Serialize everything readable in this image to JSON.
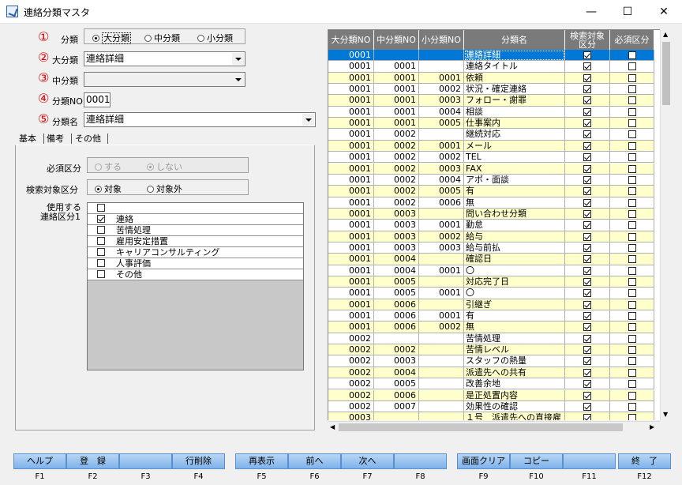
{
  "window": {
    "title": "連絡分類マスタ",
    "minimize": "—",
    "maximize": "☐",
    "close": "✕"
  },
  "markers": [
    "①",
    "②",
    "③",
    "④",
    "⑤"
  ],
  "form": {
    "bunrui_label": "分類",
    "bunrui_options": [
      {
        "label": "大分類",
        "selected": true
      },
      {
        "label": "中分類",
        "selected": false
      },
      {
        "label": "小分類",
        "selected": false
      }
    ],
    "dai_label": "大分類",
    "dai_value": "連絡詳細",
    "chu_label": "中分類",
    "chu_value": "",
    "no_label": "分類NO",
    "no_value": "0001",
    "name_label": "分類名",
    "name_value": "連絡詳細"
  },
  "tabs": [
    "基本",
    "備考",
    "その他"
  ],
  "panel": {
    "hissu_label": "必須区分",
    "hissu_options": [
      {
        "label": "する",
        "selected": false
      },
      {
        "label": "しない",
        "selected": true
      }
    ],
    "kensaku_label": "検索対象区分",
    "kensaku_options": [
      {
        "label": "対象",
        "selected": true
      },
      {
        "label": "対象外",
        "selected": false
      }
    ],
    "usage_label_1": "使用する",
    "usage_label_2": "連絡区分1",
    "usage_items": [
      {
        "label": "",
        "checked": false
      },
      {
        "label": "連絡",
        "checked": true
      },
      {
        "label": "苦情処理",
        "checked": false
      },
      {
        "label": "雇用安定措置",
        "checked": false
      },
      {
        "label": "キャリアコンサルティング",
        "checked": false
      },
      {
        "label": "人事評価",
        "checked": false
      },
      {
        "label": "その他",
        "checked": false
      }
    ]
  },
  "grid": {
    "headers": [
      "大分類NO",
      "中分類NO",
      "小分類NO",
      "分類名",
      "検索対象\n区分",
      "必須区分"
    ],
    "rows": [
      [
        "0001",
        "",
        "",
        "連絡詳細",
        true,
        false
      ],
      [
        "0001",
        "0001",
        "",
        "連絡タイトル",
        true,
        false
      ],
      [
        "0001",
        "0001",
        "0001",
        "依頼",
        true,
        false
      ],
      [
        "0001",
        "0001",
        "0002",
        "状況・確定連絡",
        true,
        false
      ],
      [
        "0001",
        "0001",
        "0003",
        "フォロー・謝罪",
        true,
        false
      ],
      [
        "0001",
        "0001",
        "0004",
        "相談",
        true,
        false
      ],
      [
        "0001",
        "0001",
        "0005",
        "仕事案内",
        true,
        false
      ],
      [
        "0001",
        "0002",
        "",
        "継続対応",
        true,
        false
      ],
      [
        "0001",
        "0002",
        "0001",
        "メール",
        true,
        false
      ],
      [
        "0001",
        "0002",
        "0002",
        "TEL",
        true,
        false
      ],
      [
        "0001",
        "0002",
        "0003",
        "FAX",
        true,
        false
      ],
      [
        "0001",
        "0002",
        "0004",
        "アポ・面談",
        true,
        false
      ],
      [
        "0001",
        "0002",
        "0005",
        "有",
        true,
        false
      ],
      [
        "0001",
        "0002",
        "0006",
        "無",
        true,
        false
      ],
      [
        "0001",
        "0003",
        "",
        "問い合わせ分類",
        true,
        false
      ],
      [
        "0001",
        "0003",
        "0001",
        "勤怠",
        true,
        false
      ],
      [
        "0001",
        "0003",
        "0002",
        "給与",
        true,
        false
      ],
      [
        "0001",
        "0003",
        "0003",
        "給与前払",
        true,
        false
      ],
      [
        "0001",
        "0004",
        "",
        "確認日",
        true,
        false
      ],
      [
        "0001",
        "0004",
        "0001",
        "〇",
        true,
        false
      ],
      [
        "0001",
        "0005",
        "",
        "対応完了日",
        true,
        false
      ],
      [
        "0001",
        "0005",
        "0001",
        "〇",
        true,
        false
      ],
      [
        "0001",
        "0006",
        "",
        "引継ぎ",
        true,
        false
      ],
      [
        "0001",
        "0006",
        "0001",
        "有",
        true,
        false
      ],
      [
        "0001",
        "0006",
        "0002",
        "無",
        true,
        false
      ],
      [
        "0002",
        "",
        "",
        "苦情処理",
        true,
        false
      ],
      [
        "0002",
        "0002",
        "",
        "苦情レベル",
        true,
        false
      ],
      [
        "0002",
        "0003",
        "",
        "スタッフの熱量",
        true,
        false
      ],
      [
        "0002",
        "0004",
        "",
        "派遣先への共有",
        true,
        false
      ],
      [
        "0002",
        "0005",
        "",
        "改善余地",
        true,
        false
      ],
      [
        "0002",
        "0006",
        "",
        "是正処置内容",
        true,
        false
      ],
      [
        "0002",
        "0007",
        "",
        "効果性の確認",
        true,
        false
      ],
      [
        "0003",
        "",
        "",
        "１号　派遣先への直接雇",
        true,
        false
      ]
    ]
  },
  "fbuttons": [
    {
      "label": "ヘルプ",
      "key": "F1"
    },
    {
      "label": "登　録",
      "key": "F2"
    },
    {
      "label": "",
      "key": "F3"
    },
    {
      "label": "行削除",
      "key": "F4"
    },
    {
      "label": "再表示",
      "key": "F5"
    },
    {
      "label": "前へ",
      "key": "F6"
    },
    {
      "label": "次へ",
      "key": "F7"
    },
    {
      "label": "",
      "key": "F8"
    },
    {
      "label": "画面クリア",
      "key": "F9"
    },
    {
      "label": "コピー",
      "key": "F10"
    },
    {
      "label": "",
      "key": "F11"
    },
    {
      "label": "終　了",
      "key": "F12"
    }
  ],
  "colors": {
    "selected_row": "#0078d7",
    "alt_row": "#ffffcc",
    "header": "#7a7a7a",
    "marker": "#e00000"
  }
}
